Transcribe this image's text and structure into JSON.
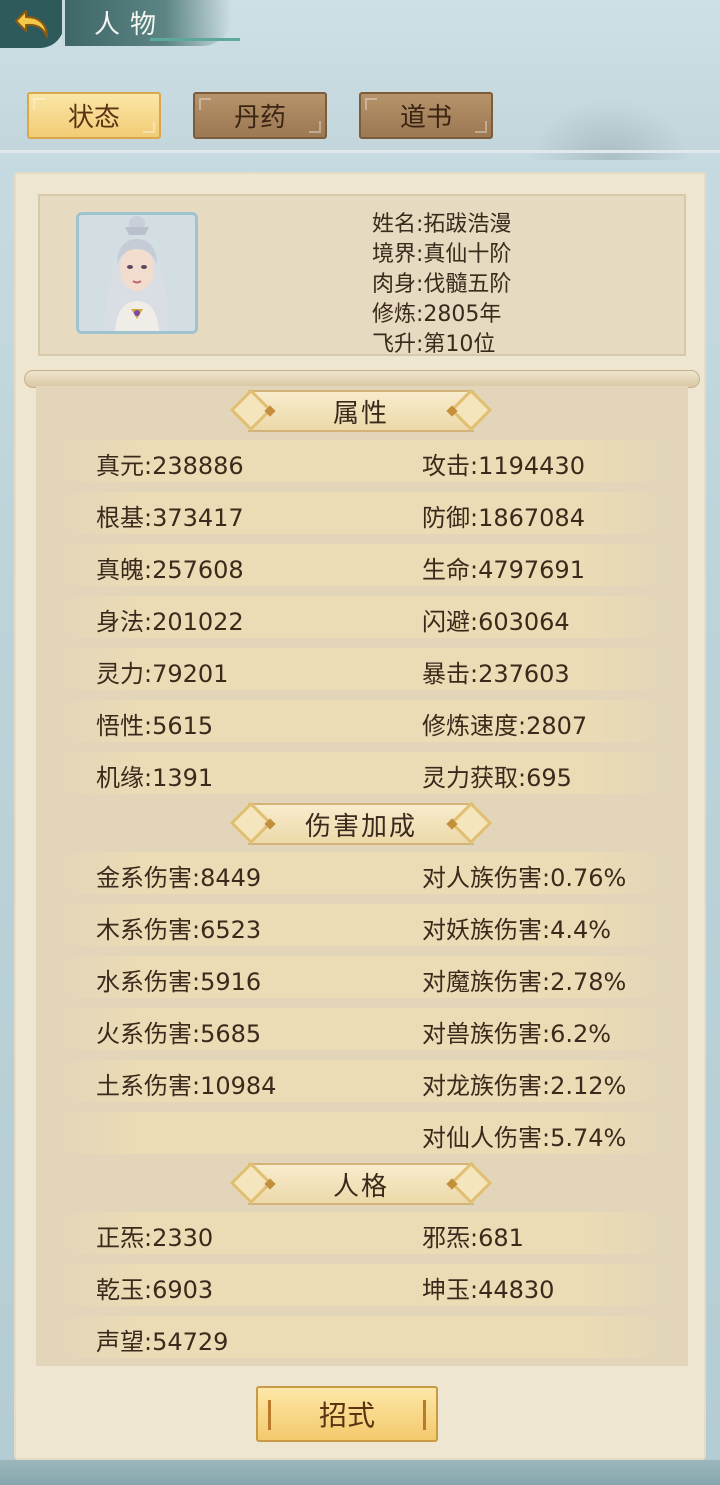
{
  "header": {
    "title": "人物",
    "tabs": [
      {
        "label": "状态",
        "active": true
      },
      {
        "label": "丹药",
        "active": false
      },
      {
        "label": "道书",
        "active": false
      }
    ]
  },
  "profile": {
    "lines": [
      "姓名:拓跋浩漫",
      "境界:真仙十阶",
      "肉身:伐髓五阶",
      "修炼:2805年",
      "飞升:第10位"
    ]
  },
  "sections": {
    "attributes": {
      "title": "属性",
      "rows": [
        [
          "真元:238886",
          "攻击:1194430"
        ],
        [
          "根基:373417",
          "防御:1867084"
        ],
        [
          "真魄:257608",
          "生命:4797691"
        ],
        [
          "身法:201022",
          "闪避:603064"
        ],
        [
          "灵力:79201",
          "暴击:237603"
        ],
        [
          "悟性:5615",
          "修炼速度:2807"
        ],
        [
          "机缘:1391",
          "灵力获取:695"
        ]
      ]
    },
    "damage": {
      "title": "伤害加成",
      "rows": [
        [
          "金系伤害:8449",
          "对人族伤害:0.76%"
        ],
        [
          "木系伤害:6523",
          "对妖族伤害:4.4%"
        ],
        [
          "水系伤害:5916",
          "对魔族伤害:2.78%"
        ],
        [
          "火系伤害:5685",
          "对兽族伤害:6.2%"
        ],
        [
          "土系伤害:10984",
          "对龙族伤害:2.12%"
        ],
        [
          "",
          "对仙人伤害:5.74%"
        ]
      ]
    },
    "personality": {
      "title": "人格",
      "rows": [
        [
          "正炁:2330",
          "邪炁:681"
        ],
        [
          "乾玉:6903",
          "坤玉:44830"
        ],
        [
          "声望:54729",
          ""
        ]
      ]
    }
  },
  "footer": {
    "skill_button": "招式"
  },
  "colors": {
    "tab_active": "#f2cc76",
    "tab_inactive": "#9c7853",
    "panel_bg": "#efe6d2",
    "text": "#3b2a1c"
  }
}
